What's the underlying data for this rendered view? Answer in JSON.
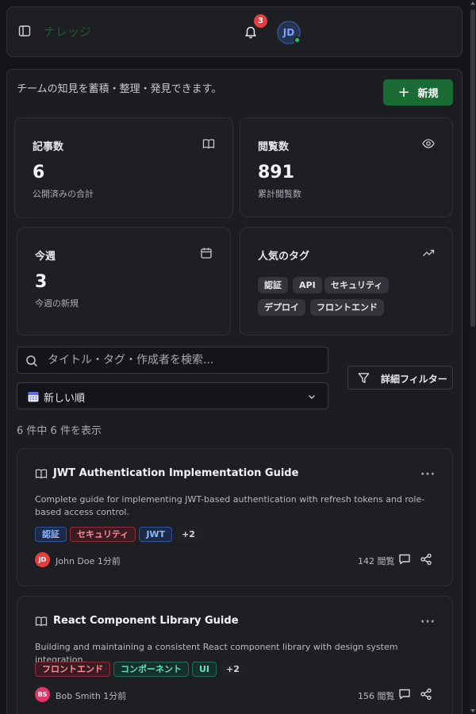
{
  "header": {
    "title": "ナレッジ",
    "notification_count": "3",
    "avatar_initials": "JD"
  },
  "main": {
    "subtitle": "チームの知見を蓄積・整理・発見できます。",
    "new_button_label": "新規"
  },
  "stats": {
    "articles": {
      "title": "記事数",
      "value": "6",
      "desc": "公開済みの合計",
      "icon": "book-icon"
    },
    "views": {
      "title": "閲覧数",
      "value": "891",
      "desc": "累計閲覧数",
      "icon": "eye-icon"
    },
    "week": {
      "title": "今週",
      "value": "3",
      "desc": "今週の新規",
      "icon": "calendar-icon"
    },
    "tags": {
      "title": "人気のタグ",
      "icon": "trending-up-icon",
      "items": [
        "認証",
        "API",
        "セキュリティ",
        "デプロイ",
        "フロントエンド"
      ]
    }
  },
  "search": {
    "placeholder": "タイトル・タグ・作成者を検索..."
  },
  "filter": {
    "label": "詳細フィルター"
  },
  "sort": {
    "selected": "新しい順"
  },
  "result_count": "6 件中 6 件を表示",
  "articles": [
    {
      "title": "JWT Authentication Implementation Guide",
      "description": "Complete guide for implementing JWT-based authentication with refresh tokens and role-based access control.",
      "tags": [
        {
          "label": "認証",
          "color": "#8cb4ff"
        },
        {
          "label": "セキュリティ",
          "color": "#ff8c99"
        },
        {
          "label": "JWT",
          "color": "#8cb4ff"
        }
      ],
      "more_tags": "+2",
      "author_initials": "JD",
      "author_color": "#e53e3e",
      "author": "John Doe",
      "time": "1分前",
      "views": "142 閲覧"
    },
    {
      "title": "React Component Library Guide",
      "description": "Building and maintaining a consistent React component library with design system integration.",
      "tags": [
        {
          "label": "フロントエンド",
          "color": "#ff8c99"
        },
        {
          "label": "コンポーネント",
          "color": "#5ee0c2"
        },
        {
          "label": "UI",
          "color": "#5ee0c2"
        }
      ],
      "more_tags": "+2",
      "author_initials": "BS",
      "author_color": "#e5336b",
      "author": "Bob Smith",
      "time": "1分前",
      "views": "156 閲覧"
    }
  ],
  "colors": {
    "accent_green": "#1a6b34",
    "background": "#141518",
    "card": "#1e1f23"
  }
}
